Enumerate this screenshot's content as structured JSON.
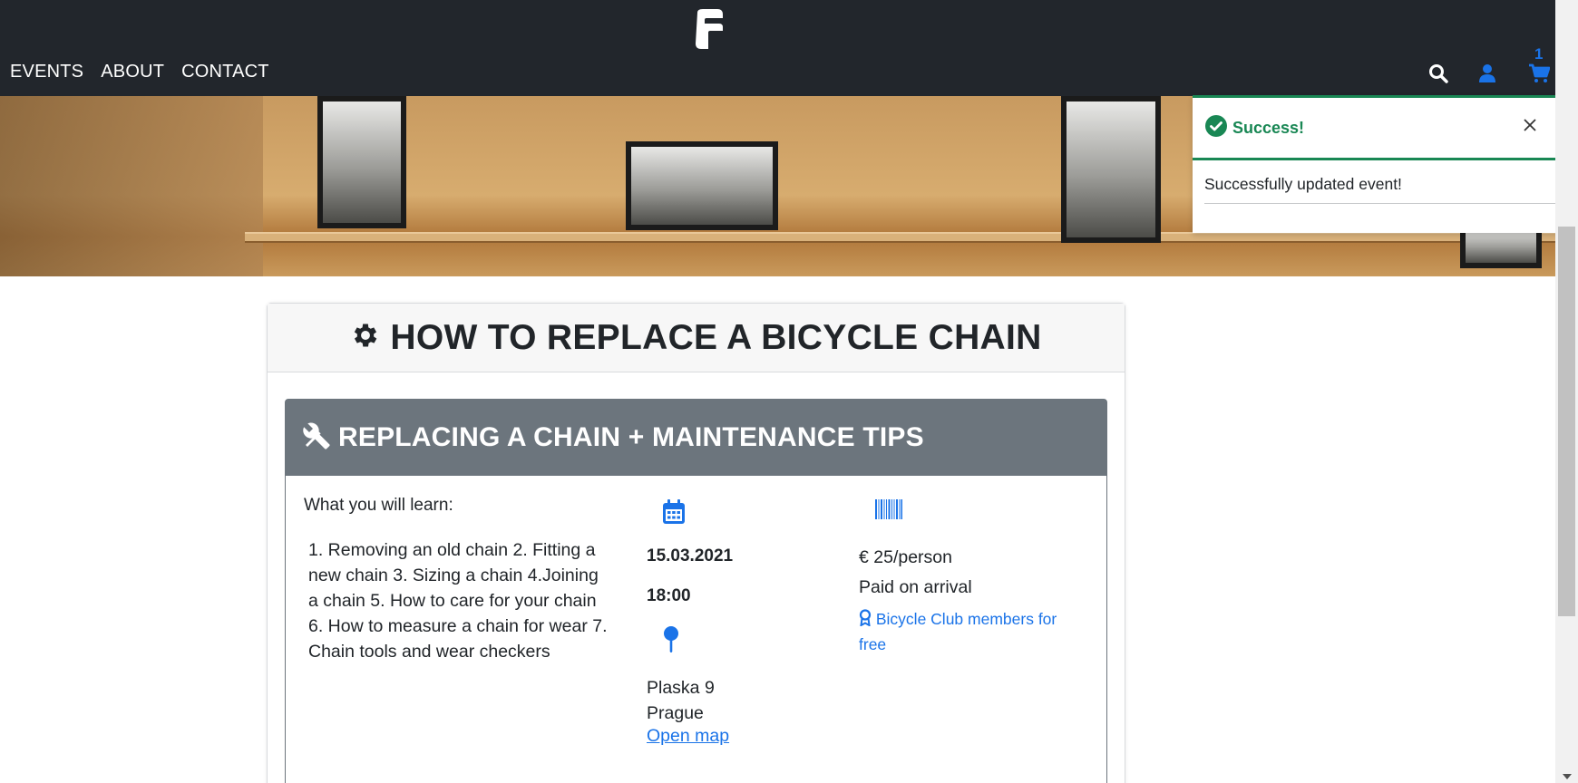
{
  "nav": {
    "links": [
      "EVENTS",
      "ABOUT",
      "CONTACT"
    ],
    "cart_count": "1"
  },
  "event": {
    "title": "HOW TO REPLACE A BICYCLE CHAIN",
    "subtitle": "REPLACING A CHAIN + MAINTENANCE TIPS",
    "learn_heading": "What you will learn:",
    "learn_body": "1. Removing an old chain 2. Fitting a new chain 3. Sizing a chain 4.Joining a chain 5. How to care for your chain 6. How to measure a chain for wear 7. Chain tools and wear checkers",
    "date": "15.03.2021",
    "time": "18:00",
    "address_line1": "Plaska 9",
    "address_line2": "Prague",
    "map_link": "Open map",
    "price": "€ 25/person",
    "payment": "Paid on arrival",
    "member_note": "Bicycle Club members for free"
  },
  "toast": {
    "title": "Success!",
    "message": "Successfully updated event!"
  },
  "colors": {
    "navbar": "#22262c",
    "accent_blue": "#1a73e8",
    "success_green": "#198754",
    "inner_header": "#6c757d"
  },
  "icons": {
    "logo": "bike-shop-logo",
    "search": "search-icon",
    "user": "user-icon",
    "cart": "cart-icon",
    "title": "gear-icon",
    "subtitle": "tools-icon",
    "date": "calendar-icon",
    "location": "pin-icon",
    "price": "barcode-icon",
    "member": "award-icon",
    "toast_status": "check-circle-icon",
    "toast_close": "close-icon"
  }
}
